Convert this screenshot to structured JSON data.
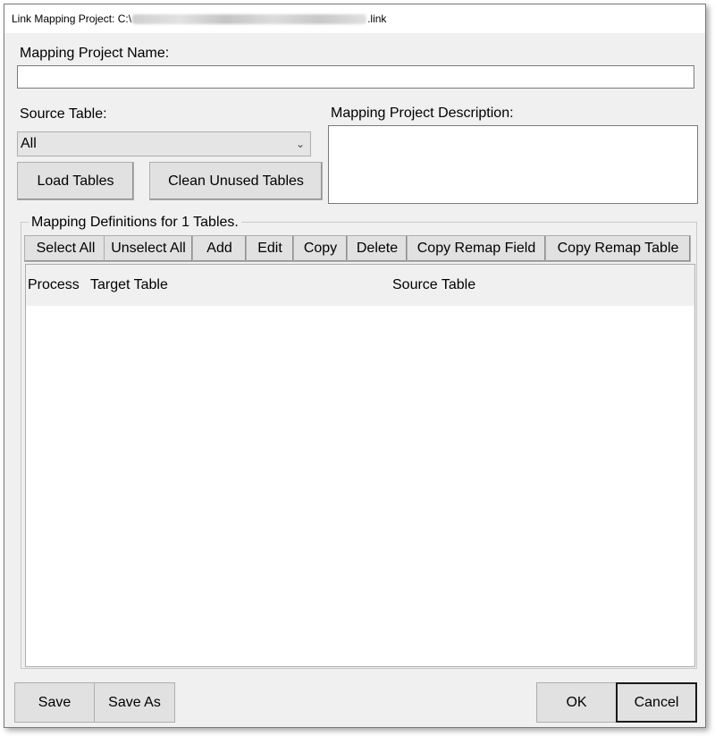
{
  "window": {
    "title_prefix": "Link Mapping Project: C:\\",
    "title_suffix": ".link"
  },
  "project_name": {
    "label": "Mapping Project Name:",
    "value": ""
  },
  "source_table": {
    "label": "Source Table:",
    "selected": "All"
  },
  "description": {
    "label": "Mapping Project Description:",
    "value": ""
  },
  "buttons": {
    "load_tables": "Load Tables",
    "clean_unused_tables": "Clean Unused Tables",
    "save": "Save",
    "save_as": "Save As",
    "ok": "OK",
    "cancel": "Cancel"
  },
  "mapping": {
    "group_label": "Mapping Definitions for 1 Tables.",
    "toolbar": {
      "select_all": "Select All",
      "unselect_all": "Unselect All",
      "add": "Add",
      "edit": "Edit",
      "copy": "Copy",
      "delete": "Delete",
      "copy_remap_field": "Copy Remap Field",
      "copy_remap_table": "Copy Remap Table"
    },
    "columns": {
      "process": "Process",
      "target_table": "Target Table",
      "source_table": "Source Table"
    },
    "rows": []
  },
  "colors": {
    "window_bg": "#f0f0f0",
    "button_bg": "#e1e1e1",
    "border": "#adadad"
  }
}
